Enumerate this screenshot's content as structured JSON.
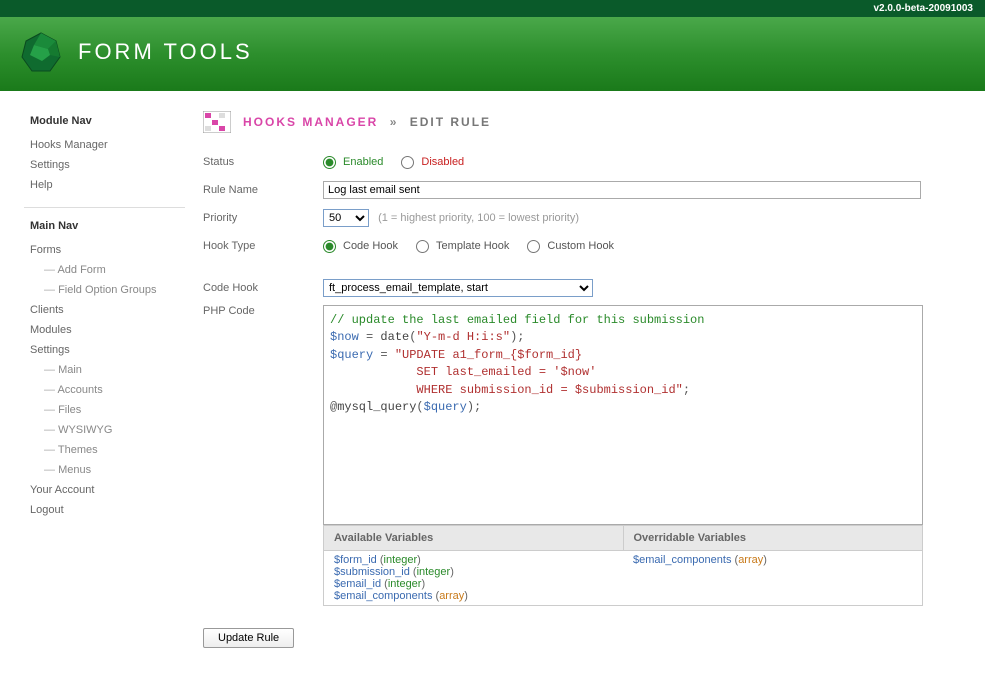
{
  "version": "v2.0.0-beta-20091003",
  "app_name": "FORM TOOLS",
  "sidebar": {
    "module_nav": {
      "heading": "Module Nav",
      "items": [
        "Hooks Manager",
        "Settings",
        "Help"
      ]
    },
    "main_nav": {
      "heading": "Main Nav",
      "items": [
        {
          "label": "Forms",
          "sub": [
            "Add Form",
            "Field Option Groups"
          ]
        },
        {
          "label": "Clients"
        },
        {
          "label": "Modules"
        },
        {
          "label": "Settings",
          "sub": [
            "Main",
            "Accounts",
            "Files",
            "WYSIWYG",
            "Themes",
            "Menus"
          ]
        },
        {
          "label": "Your Account"
        },
        {
          "label": "Logout"
        }
      ]
    }
  },
  "breadcrumb": {
    "section": "HOOKS MANAGER",
    "sep": "»",
    "page": "EDIT RULE"
  },
  "labels": {
    "status": "Status",
    "rule_name": "Rule Name",
    "priority": "Priority",
    "hook_type": "Hook Type",
    "code_hook": "Code Hook",
    "php_code": "PHP Code",
    "enabled": "Enabled",
    "disabled": "Disabled",
    "template_hook": "Template Hook",
    "custom_hook": "Custom Hook",
    "code_hook_radio": "Code Hook",
    "priority_hint": "(1 = highest priority, 100 = lowest priority)",
    "available_vars": "Available Variables",
    "overridable_vars": "Overridable Variables",
    "update": "Update Rule"
  },
  "values": {
    "rule_name": "Log last email sent",
    "priority": "50",
    "status": "enabled",
    "hook_type": "code",
    "code_hook_select": "ft_process_email_template, start"
  },
  "code": {
    "line1": "// update the last emailed field for this submission",
    "line2_a": "$now",
    "line2_b": " = ",
    "line2_c": "date",
    "line2_d": "(",
    "line2_e": "\"Y-m-d H:i:s\"",
    "line2_f": ");",
    "line3_a": "$query",
    "line3_b": " = ",
    "line3_c": "\"UPDATE a1_form_{$form_id}",
    "line4": "            SET last_emailed = '$now'",
    "line5": "            WHERE submission_id = $submission_id\"",
    "line5_b": ";",
    "line6_a": "@",
    "line6_b": "mysql_query",
    "line6_c": "(",
    "line6_d": "$query",
    "line6_e": ");"
  },
  "available_vars": [
    {
      "name": "$form_id",
      "type": "integer"
    },
    {
      "name": "$submission_id",
      "type": "integer"
    },
    {
      "name": "$email_id",
      "type": "integer"
    },
    {
      "name": "$email_components",
      "type": "array"
    }
  ],
  "overridable_vars": [
    {
      "name": "$email_components",
      "type": "array"
    }
  ]
}
